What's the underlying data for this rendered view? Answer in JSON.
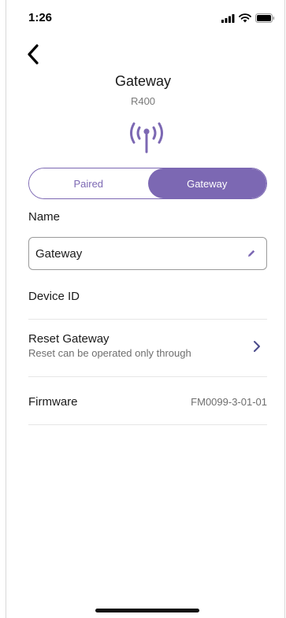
{
  "status_bar": {
    "time": "1:26",
    "icons": [
      "signal-icon",
      "wifi-icon",
      "battery-icon"
    ]
  },
  "header": {
    "back_icon": "chevron-left-icon"
  },
  "device": {
    "title": "Gateway",
    "model": "R400",
    "icon": "antenna-icon",
    "accent_color": "#7c68b3"
  },
  "segmented": {
    "items": [
      {
        "label": "Paired",
        "selected": false
      },
      {
        "label": "Gateway",
        "selected": true
      }
    ]
  },
  "form": {
    "name_label": "Name",
    "name_value": "Gateway",
    "edit_icon": "pencil-icon"
  },
  "rows": {
    "device_id_label": "Device ID",
    "reset_title": "Reset Gateway",
    "reset_subtitle": "Reset can be operated only through",
    "firmware_label": "Firmware",
    "firmware_value": "FM0099-3-01-01"
  }
}
